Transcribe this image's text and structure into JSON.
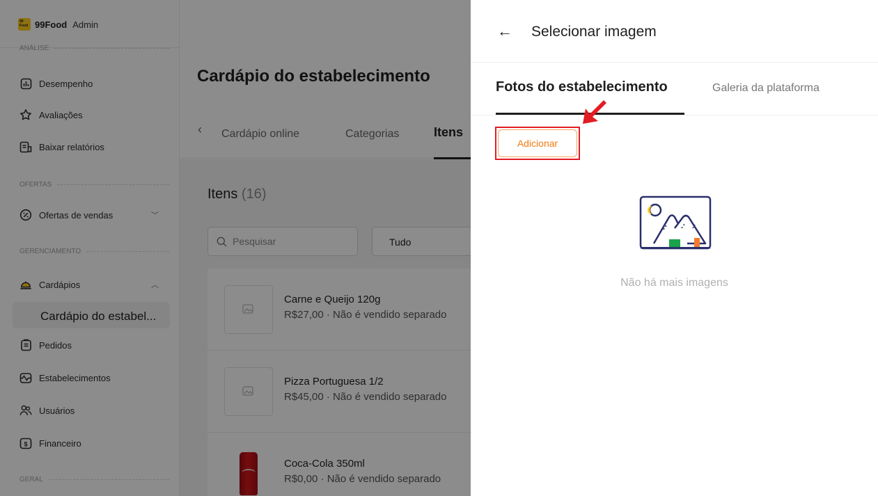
{
  "brand": {
    "logo_text": "99 Food",
    "name": "99Food",
    "suffix": "Admin"
  },
  "sidebar": {
    "sections": [
      {
        "label": "ANÁLISE"
      },
      {
        "label": "OFERTAS"
      },
      {
        "label": "GERENCIAMENTO"
      },
      {
        "label": "GERAL"
      }
    ],
    "items": [
      {
        "label": "Desempenho",
        "icon": "chart-icon"
      },
      {
        "label": "Avaliações",
        "icon": "star-icon"
      },
      {
        "label": "Baixar relatórios",
        "icon": "report-icon"
      },
      {
        "label": "Ofertas de vendas",
        "icon": "discount-icon",
        "chevron": "﹀"
      },
      {
        "label": "Cardápios",
        "icon": "cloche-icon",
        "chevron": "︿"
      },
      {
        "label": "Cardápio do estabel...",
        "icon": ""
      },
      {
        "label": "Pedidos",
        "icon": "clipboard-icon"
      },
      {
        "label": "Estabelecimentos",
        "icon": "store-icon"
      },
      {
        "label": "Usuários",
        "icon": "users-icon"
      },
      {
        "label": "Financeiro",
        "icon": "money-icon"
      }
    ]
  },
  "main": {
    "title": "Cardápio do estabelecimento",
    "tabs": [
      {
        "label": "Cardápio online"
      },
      {
        "label": "Categorias"
      },
      {
        "label": "Itens"
      }
    ],
    "items_title": "Itens",
    "items_count": "(16)",
    "search_placeholder": "Pesquisar",
    "filter_value": "Tudo",
    "items": [
      {
        "name": "Carne e Queijo 120g",
        "meta": "R$27,00 · Não é vendido separado"
      },
      {
        "name": "Pizza Portuguesa 1/2",
        "meta": "R$45,00 · Não é vendido separado"
      },
      {
        "name": "Coca-Cola 350ml",
        "meta": "R$0,00 · Não é vendido separado"
      }
    ]
  },
  "drawer": {
    "back_icon": "←",
    "title": "Selecionar imagem",
    "tabs": [
      {
        "label": "Fotos do estabelecimento",
        "active": true
      },
      {
        "label": "Galeria da plataforma",
        "active": false
      }
    ],
    "add_button": "Adicionar",
    "empty_text": "Não há mais imagens"
  },
  "colors": {
    "accent_orange": "#f07a12",
    "highlight_red": "#e31b23",
    "brand_yellow": "#ffcf1f",
    "illustration_navy": "#2a2f6b"
  }
}
